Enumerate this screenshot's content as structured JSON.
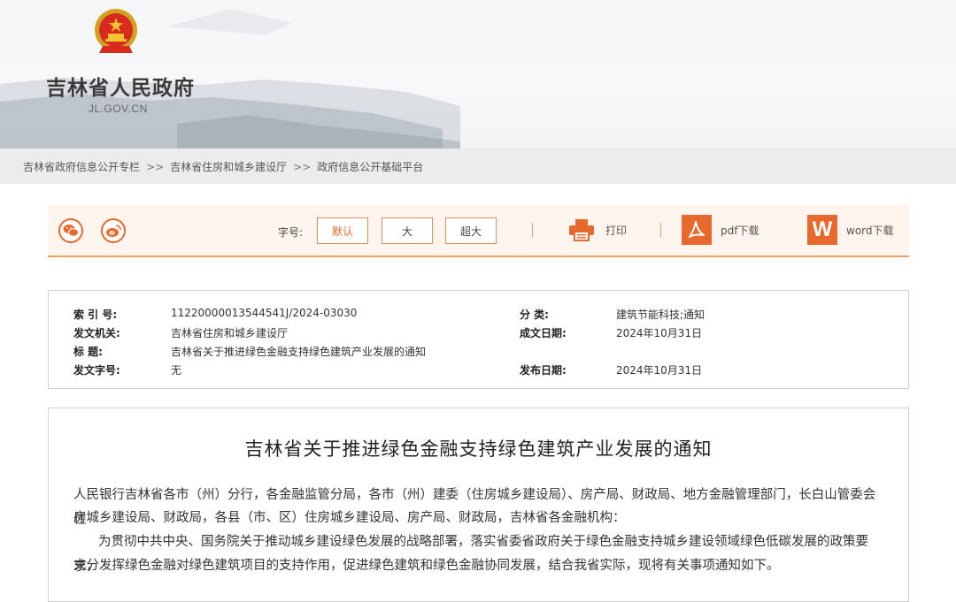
{
  "header": {
    "site_name": "吉林省人民政府",
    "site_domain": "JL.GOV.CN"
  },
  "breadcrumb": {
    "items": [
      "吉林省政府信息公开专栏",
      "吉林省住房和城乡建设厅",
      "政府信息公开基础平台"
    ],
    "separator": ">>"
  },
  "toolbar": {
    "font_size_label": "字号:",
    "size_default": "默认",
    "size_large": "大",
    "size_xlarge": "超大",
    "print_label": "打印",
    "pdf_label": "pdf下载",
    "word_label": "word下载",
    "word_icon_letter": "W",
    "accent_color": "#e8692e"
  },
  "meta": {
    "index_label": "索 引 号:",
    "index_value": "11220000013544541J/2024-03030",
    "category_label": "分 类:",
    "category_value": "建筑节能科技;通知",
    "issuer_label": "发文机关:",
    "issuer_value": "吉林省住房和城乡建设厅",
    "created_label": "成文日期:",
    "created_value": "2024年10月31日",
    "title_label": "标 题:",
    "title_value": "吉林省关于推进绿色金融支持绿色建筑产业发展的通知",
    "docno_label": "发文字号:",
    "docno_value": "无",
    "published_label": "发布日期:",
    "published_value": "2024年10月31日"
  },
  "article": {
    "title": "吉林省关于推进绿色金融支持绿色建筑产业发展的通知",
    "lines": [
      "人民银行吉林省各市（州）分行，各金融监管分局，各市（州）建委（住房城乡建设局）、房产局、财政局、地方金融管理部门，长白山管委会住",
      "房城乡建设局、财政局，各县（市、区）住房城乡建设局、房产局、财政局，吉林省各金融机构：",
      "为贯彻中共中央、国务院关于推动城乡建设绿色发展的战略部署，落实省委省政府关于绿色金融支持城乡建设领域绿色低碳发展的政策要求，",
      "充分发挥绿色金融对绿色建筑项目的支持作用，促进绿色建筑和绿色金融协同发展，结合我省实际，现将有关事项通知如下。"
    ]
  }
}
